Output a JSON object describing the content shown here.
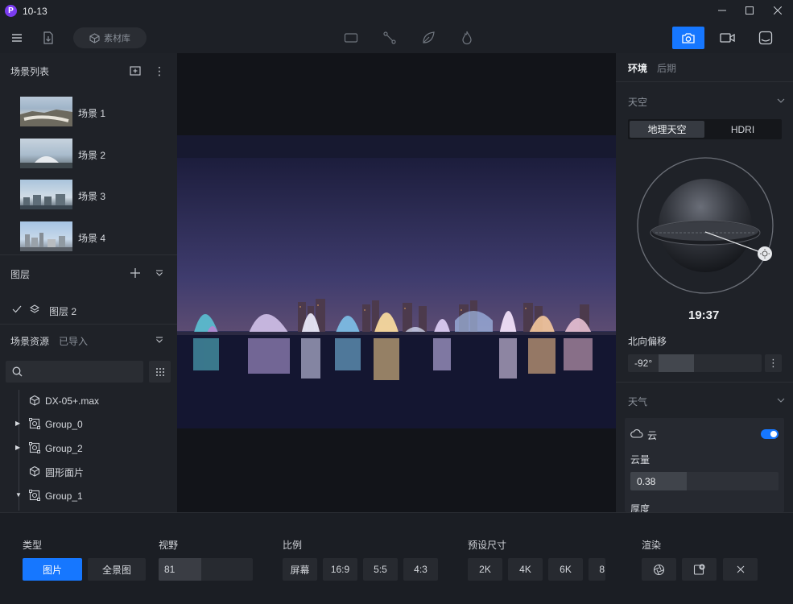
{
  "window": {
    "title": "10-13"
  },
  "toolbar": {
    "asset_library": "素材库"
  },
  "scenes": {
    "header": "场景列表",
    "items": [
      {
        "label": "场景 1"
      },
      {
        "label": "场景 2"
      },
      {
        "label": "场景 3"
      },
      {
        "label": "场景 4"
      }
    ]
  },
  "layers": {
    "header": "图层",
    "items": [
      {
        "label": "图层 2"
      }
    ]
  },
  "resources": {
    "tab_active": "场景资源",
    "tab_inactive": "已导入",
    "search_placeholder": "",
    "tree": [
      {
        "label": "DX-05+.max",
        "icon": "cube-icon",
        "expandable": false
      },
      {
        "label": "Group_0",
        "icon": "group-icon",
        "expandable": true,
        "expanded": false
      },
      {
        "label": "Group_2",
        "icon": "group-icon",
        "expandable": true,
        "expanded": false
      },
      {
        "label": "圆形面片",
        "icon": "cube-icon",
        "expandable": false
      },
      {
        "label": "Group_1",
        "icon": "group-icon",
        "expandable": true,
        "expanded": true
      }
    ]
  },
  "right": {
    "tabs": {
      "env": "环境",
      "post": "后期"
    },
    "sky": {
      "header": "天空",
      "geo_sky": "地理天空",
      "hdri": "HDRI",
      "time": "19:37",
      "north_offset_label": "北向偏移",
      "north_offset_value": "-92°"
    },
    "weather": {
      "header": "天气",
      "cloud_label": "云",
      "cloud_enabled": true,
      "cloud_amount_label": "云量",
      "cloud_amount_value": "0.38",
      "thickness_label": "厚度"
    }
  },
  "bottom": {
    "type_label": "类型",
    "type_picture": "图片",
    "type_panorama": "全景图",
    "fov_label": "视野",
    "fov_value": "81",
    "ratio_label": "比例",
    "ratios": [
      "屏幕",
      "16:9",
      "5:5",
      "4:3"
    ],
    "preset_label": "预设尺寸",
    "presets": [
      "2K",
      "4K",
      "6K",
      "8"
    ],
    "render_label": "渲染"
  },
  "colors": {
    "accent": "#1677ff",
    "bg": "#1c1f25",
    "panel": "#1f2228"
  }
}
